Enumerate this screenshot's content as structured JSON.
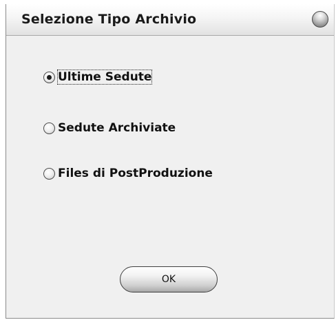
{
  "window": {
    "title": "Selezione Tipo Archivio"
  },
  "options": [
    {
      "label": "Ultime Sedute",
      "selected": true
    },
    {
      "label": "Sedute Archiviate",
      "selected": false
    },
    {
      "label": "Files di PostProduzione",
      "selected": false
    }
  ],
  "buttons": {
    "ok_label": "OK"
  },
  "icons": {
    "close": "close-orb-icon"
  },
  "colors": {
    "window_bg": "#f0f0f0",
    "titlebar_top": "#ffffff",
    "titlebar_bottom": "#e2e2e2",
    "text": "#111111"
  }
}
